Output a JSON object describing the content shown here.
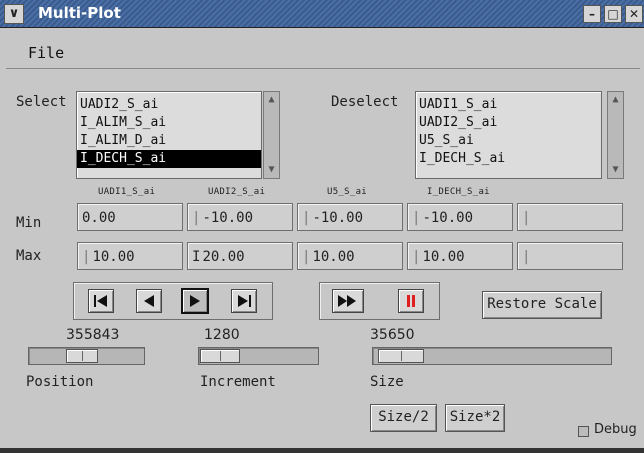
{
  "window": {
    "title": "Multi-Plot"
  },
  "menu": {
    "file": "File"
  },
  "select": {
    "label": "Select",
    "items": [
      {
        "label": "UADI2_S_ai",
        "selected": false
      },
      {
        "label": "I_ALIM_S_ai",
        "selected": false
      },
      {
        "label": "I_ALIM_D_ai",
        "selected": false
      },
      {
        "label": "I_DECH_S_ai",
        "selected": true
      }
    ]
  },
  "deselect": {
    "label": "Deselect",
    "items": [
      {
        "label": "UADI1_S_ai"
      },
      {
        "label": "UADI2_S_ai"
      },
      {
        "label": "U5_S_ai"
      },
      {
        "label": "I_DECH_S_ai"
      }
    ]
  },
  "columns": [
    "UADI1_S_ai",
    "UADI2_S_ai",
    "U5_S_ai",
    "I_DECH_S_ai",
    ""
  ],
  "min": {
    "label": "Min",
    "values": [
      "0.00",
      "-10.00",
      "-10.00",
      "-10.00",
      ""
    ]
  },
  "max": {
    "label": "Max",
    "values": [
      "10.00",
      "20.00",
      "10.00",
      "10.00",
      ""
    ]
  },
  "playback": {
    "icons": [
      "skip-to-start-icon",
      "step-back-icon",
      "play-icon",
      "skip-to-end-icon",
      "fast-forward-icon",
      "pause-icon"
    ],
    "active": "play-icon"
  },
  "restore_scale": "Restore Scale",
  "sliders": {
    "position": {
      "label": "Position",
      "value": "355843",
      "thumb_fraction": 0.45
    },
    "increment": {
      "label": "Increment",
      "value": "1280",
      "thumb_fraction": 0.0
    },
    "size": {
      "label": "Size",
      "value": "35650",
      "thumb_fraction": 0.02
    }
  },
  "size_half": "Size/2",
  "size_double": "Size*2",
  "debug": {
    "label": "Debug",
    "checked": false
  },
  "colors": {
    "pause": "#e02020",
    "selection": "#000000"
  }
}
